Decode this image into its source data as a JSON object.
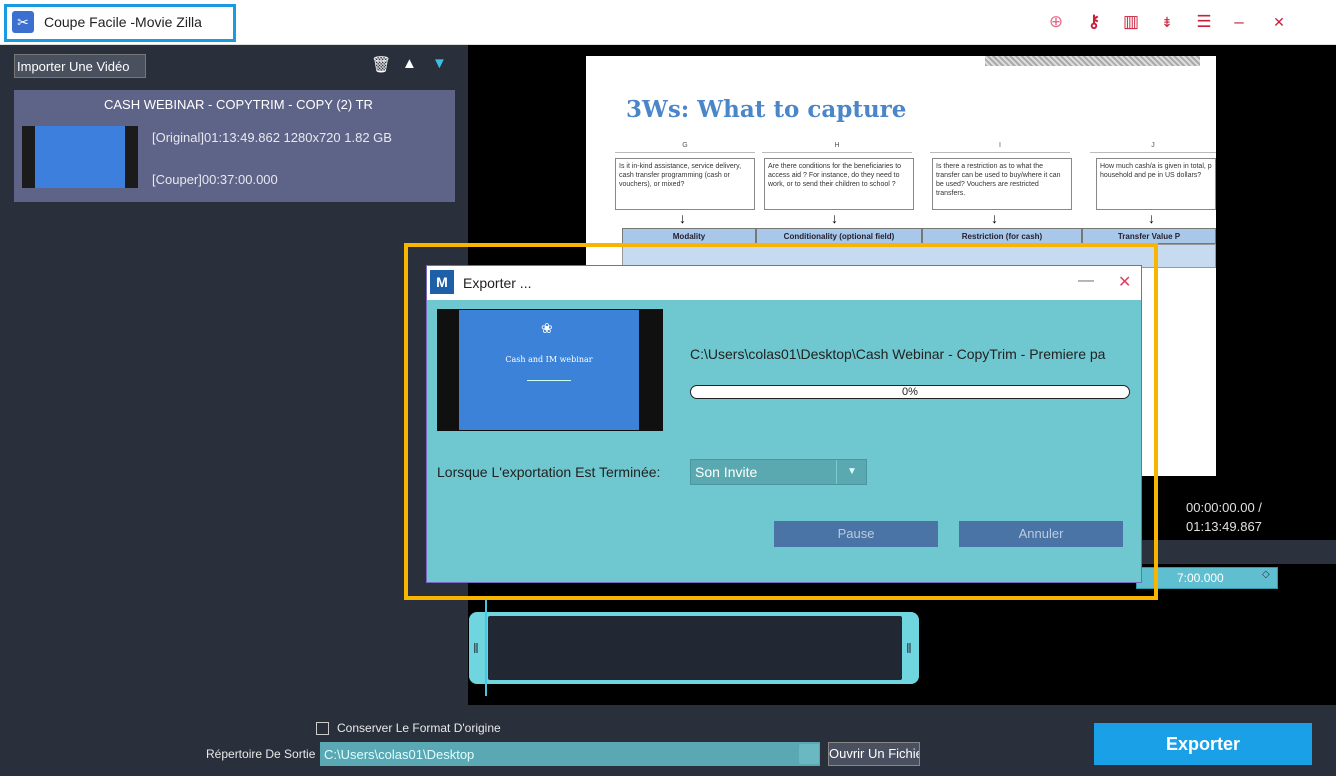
{
  "window": {
    "title": "Coupe Facile -Movie Zilla",
    "icons": [
      "cart-icon",
      "key-icon",
      "layout-icon",
      "sort-icon",
      "list-icon",
      "minimize-icon",
      "close-icon"
    ],
    "accent_color": "#1aa0e6",
    "highlight_color": "#f7b500"
  },
  "left_panel": {
    "import_label": "Importer Une Vidéo",
    "item": {
      "name": "CASH WEBINAR - COPYTRIM - COPY (2) TR",
      "original": "[Original]01:13:49.862 1280x720 1.82 GB",
      "cut": "[Couper]00:37:00.000"
    }
  },
  "preview": {
    "doc_title": "3Ws: What to capture",
    "columns": [
      "G",
      "H",
      "I",
      "J"
    ],
    "questions": [
      "Is it in-kind assistance, service delivery, cash transfer programming (cash or vouchers), or mixed?",
      "Are there conditions for the beneficiaries to access aid ? For instance, do they need to work, or to send their children to school ?",
      "Is there a restriction as to what the transfer can be used to buy/where it can be used? Vouchers are restricted transfers.",
      "How much cash/a is given in total, p household and pe in US dollars?"
    ],
    "headers": [
      "Modality",
      "Conditionality (optional field)",
      "Restriction (for cash)",
      "Transfer Value P"
    ],
    "time_current": "00:00:00.00 /",
    "time_total": "01:13:49.867",
    "time_field": "7:00.000"
  },
  "bottom": {
    "keep_format_label": "Conserver Le Format D'origine",
    "keep_format_checked": false,
    "dir_label": "Répertoire De Sortie",
    "dir_value": "C:\\Users\\colas01\\Desktop",
    "open_file_label": "Ouvrir Un Fichier",
    "export_label": "Exporter"
  },
  "dialog": {
    "title": "Exporter ...",
    "slide_title": "Cash and IM webinar",
    "path": "C:\\Users\\colas01\\Desktop\\Cash Webinar - CopyTrim - Premiere pa",
    "progress": 0,
    "progress_text": "0%",
    "when_done_label": "Lorsque L'exportation Est Terminée:",
    "when_done_value": "Son Invite",
    "pause_label": "Pause",
    "cancel_label": "Annuler"
  }
}
